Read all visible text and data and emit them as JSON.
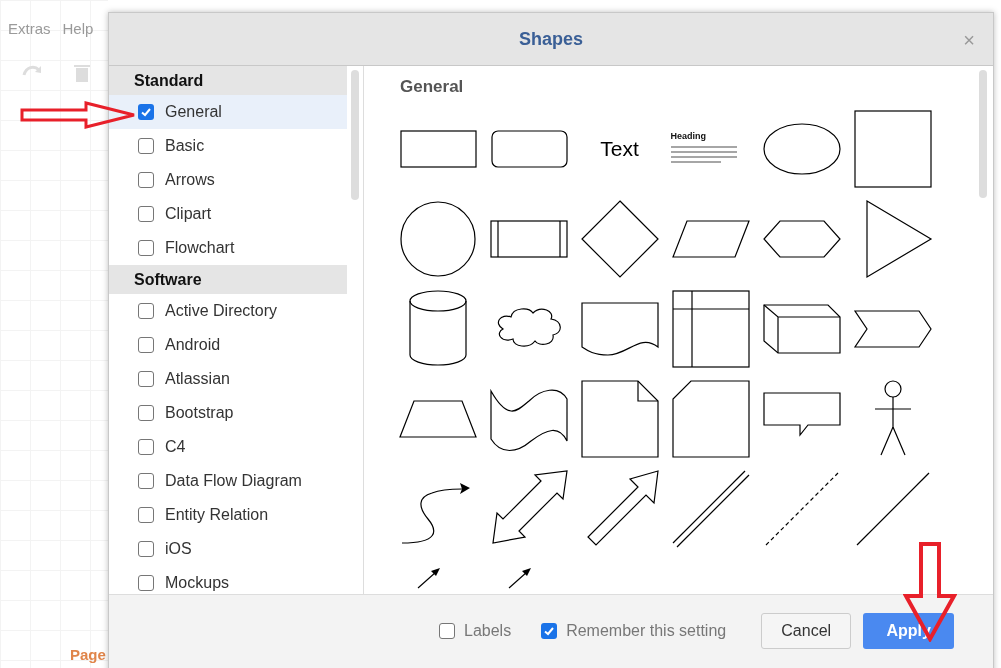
{
  "background": {
    "menu": [
      "Extras",
      "Help"
    ],
    "page_tab": "Page"
  },
  "dialog": {
    "title": "Shapes",
    "close": "×",
    "sections": [
      {
        "title": "Standard",
        "items": [
          {
            "label": "General",
            "checked": true,
            "selected": true
          },
          {
            "label": "Basic",
            "checked": false,
            "selected": false
          },
          {
            "label": "Arrows",
            "checked": false,
            "selected": false
          },
          {
            "label": "Clipart",
            "checked": false,
            "selected": false
          },
          {
            "label": "Flowchart",
            "checked": false,
            "selected": false
          }
        ]
      },
      {
        "title": "Software",
        "items": [
          {
            "label": "Active Directory",
            "checked": false,
            "selected": false
          },
          {
            "label": "Android",
            "checked": false,
            "selected": false
          },
          {
            "label": "Atlassian",
            "checked": false,
            "selected": false
          },
          {
            "label": "Bootstrap",
            "checked": false,
            "selected": false
          },
          {
            "label": "C4",
            "checked": false,
            "selected": false
          },
          {
            "label": "Data Flow Diagram",
            "checked": false,
            "selected": false
          },
          {
            "label": "Entity Relation",
            "checked": false,
            "selected": false
          },
          {
            "label": "iOS",
            "checked": false,
            "selected": false
          },
          {
            "label": "Mockups",
            "checked": false,
            "selected": false
          }
        ]
      }
    ],
    "preview": {
      "title": "General",
      "shapes": [
        {
          "kind": "rectangle"
        },
        {
          "kind": "rounded"
        },
        {
          "kind": "text",
          "text": "Text"
        },
        {
          "kind": "textbox",
          "heading": "Heading"
        },
        {
          "kind": "ellipse"
        },
        {
          "kind": "square"
        },
        {
          "kind": "circle"
        },
        {
          "kind": "process"
        },
        {
          "kind": "diamond"
        },
        {
          "kind": "parallelogram"
        },
        {
          "kind": "hexagon"
        },
        {
          "kind": "triangle"
        },
        {
          "kind": "cylinder"
        },
        {
          "kind": "cloud"
        },
        {
          "kind": "document"
        },
        {
          "kind": "storage"
        },
        {
          "kind": "cube"
        },
        {
          "kind": "step"
        },
        {
          "kind": "trapezoid"
        },
        {
          "kind": "tape"
        },
        {
          "kind": "note"
        },
        {
          "kind": "card"
        },
        {
          "kind": "callout"
        },
        {
          "kind": "actor"
        },
        {
          "kind": "curve"
        },
        {
          "kind": "double-arrow"
        },
        {
          "kind": "block-arrow"
        },
        {
          "kind": "double-line"
        },
        {
          "kind": "dashed-line"
        },
        {
          "kind": "line"
        },
        {
          "kind": "small-arrow"
        },
        {
          "kind": "small-arrow"
        }
      ]
    },
    "footer": {
      "options": [
        {
          "label": "Labels",
          "checked": false
        },
        {
          "label": "Remember this setting",
          "checked": true
        }
      ],
      "buttons": [
        {
          "label": "Cancel",
          "kind": "secondary"
        },
        {
          "label": "Apply",
          "kind": "primary"
        }
      ]
    }
  }
}
